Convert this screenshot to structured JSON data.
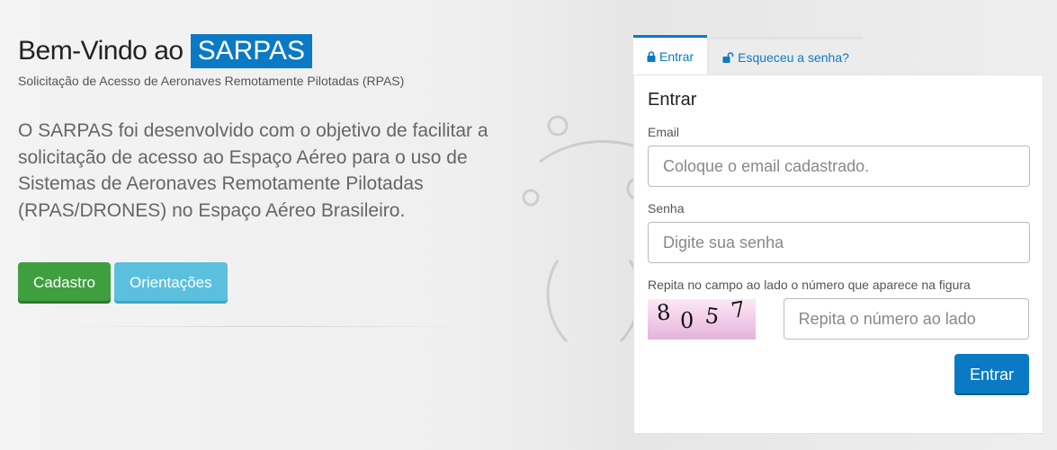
{
  "hero": {
    "title_prefix": "Bem-Vindo ao",
    "title_brand": "SARPAS",
    "subtitle": "Solicitação de Acesso de Aeronaves Remotamente Pilotadas (RPAS)",
    "lead": "O SARPAS foi desenvolvido com o objetivo de facilitar a solicitação de acesso ao Espaço Aéreo para o uso de Sistemas de Aeronaves Remotamente Pilotadas (RPAS/DRONES) no Espaço Aéreo Brasileiro.",
    "buttons": {
      "cadastro": "Cadastro",
      "orientacoes": "Orientações"
    }
  },
  "tabs": [
    {
      "label": "Entrar",
      "icon": "lock-icon",
      "active": true
    },
    {
      "label": "Esqueceu a senha?",
      "icon": "unlock-icon",
      "active": false
    }
  ],
  "login": {
    "heading": "Entrar",
    "email_label": "Email",
    "email_placeholder": "Coloque o email cadastrado.",
    "password_label": "Senha",
    "password_placeholder": "Digite sua senha",
    "captcha_label": "Repita no campo ao lado o número que aparece na figura",
    "captcha_digits": [
      "8",
      "0",
      "5",
      "7"
    ],
    "captcha_placeholder": "Repita o número ao lado",
    "submit_label": "Entrar"
  },
  "colors": {
    "brand_blue": "#0a7ac5",
    "green": "#3f9f3f",
    "cyan": "#5bc0de"
  }
}
